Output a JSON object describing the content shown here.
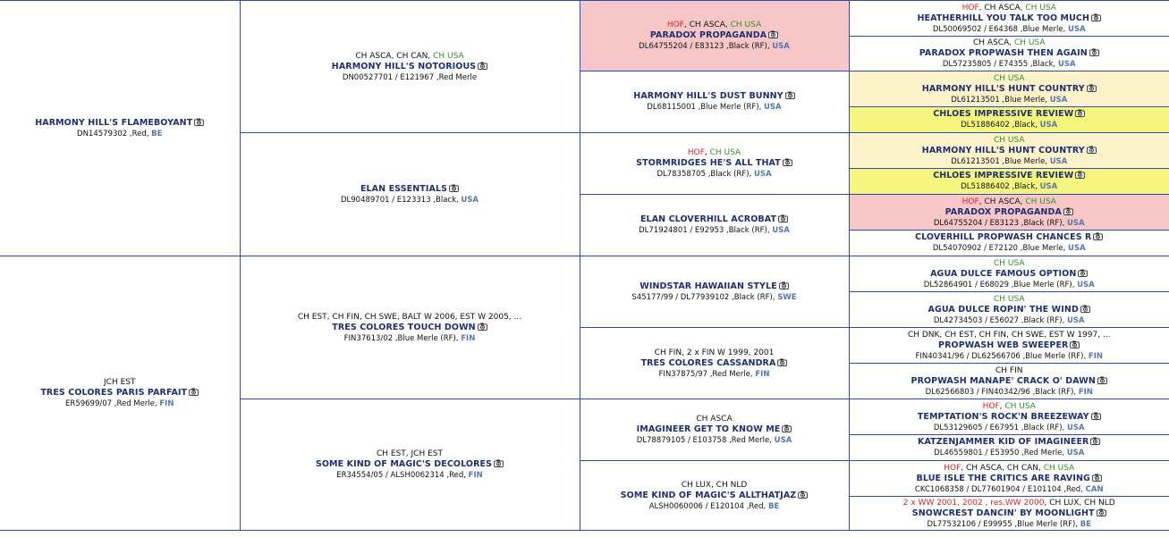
{
  "dogs": {
    "s": {
      "name": "HARMONY HILL'S FLAMEBOYANT",
      "reg": "DN14579302 ,Red, ",
      "country": "BE",
      "titles": []
    },
    "d": {
      "name": "TRES COLORES PARIS PARFAIT",
      "reg": "ER59699/07 ,Red Merle, ",
      "country": "FIN",
      "titles": [
        {
          "text": "JCH EST",
          "color": "black"
        }
      ]
    },
    "ss": {
      "name": "HARMONY HILL'S NOTORIOUS",
      "reg": "DN00527701 / E121967 ,Red Merle",
      "country": "",
      "titles": [
        {
          "text": "CH ASCA, CH CAN, ",
          "color": "black"
        },
        {
          "text": "CH USA",
          "color": "green"
        }
      ]
    },
    "sd": {
      "name": "ELAN ESSENTIALS",
      "reg": "DL90489701 / E123313 ,Black, ",
      "country": "USA",
      "titles": []
    },
    "ds": {
      "name": "TRES COLORES TOUCH DOWN",
      "reg": "FIN37613/02 ,Blue Merle (RF), ",
      "country": "FIN",
      "titles": [
        {
          "text": "CH EST, CH FIN, CH SWE, BALT W 2006, EST W 2005, ...",
          "color": "black"
        }
      ]
    },
    "dd": {
      "name": "SOME KIND OF MAGIC'S DECOLORES",
      "reg": "ER34554/05 / ALSH0062314 ,Red, ",
      "country": "FIN",
      "titles": [
        {
          "text": "CH EST, JCH EST",
          "color": "black"
        }
      ]
    },
    "sss": {
      "name": "PARADOX PROPAGANDA",
      "reg": "DL64755204 / E83123 ,Black (RF), ",
      "country": "USA",
      "titles": [
        {
          "text": "HOF",
          "color": "red"
        },
        {
          "text": ", CH ASCA, ",
          "color": "black"
        },
        {
          "text": "CH USA",
          "color": "green"
        }
      ]
    },
    "ssd": {
      "name": "HARMONY HILL'S DUST BUNNY",
      "reg": "DL68115001 ,Blue Merle (RF), ",
      "country": "USA",
      "titles": []
    },
    "sds": {
      "name": "STORMRIDGES HE'S ALL THAT",
      "reg": "DL78358705 ,Black (RF), ",
      "country": "USA",
      "titles": [
        {
          "text": "HOF",
          "color": "red"
        },
        {
          "text": ", ",
          "color": "black"
        },
        {
          "text": "CH USA",
          "color": "green"
        }
      ]
    },
    "sdd": {
      "name": "ELAN CLOVERHILL ACROBAT",
      "reg": "DL71924801 / E92953 ,Black (RF), ",
      "country": "USA",
      "titles": []
    },
    "dss": {
      "name": "WINDSTAR HAWAIIAN STYLE",
      "reg": "S45177/99 / DL77939102 ,Black (RF), ",
      "country": "SWE",
      "titles": []
    },
    "dsd": {
      "name": "TRES COLORES CASSANDRA",
      "reg": "FIN37875/97 ,Red Merle, ",
      "country": "FIN",
      "titles": [
        {
          "text": "CH FIN, 2 x FIN W 1999, 2001",
          "color": "black"
        }
      ]
    },
    "dds": {
      "name": "IMAGINEER GET TO KNOW ME",
      "reg": "DL78879105 / E103758 ,Red Merle, ",
      "country": "USA",
      "titles": [
        {
          "text": "CH ASCA",
          "color": "black"
        }
      ]
    },
    "ddd": {
      "name": "SOME KIND OF MAGIC'S ALLTHATJAZ",
      "reg": "ALSH0060006 / E120104 ,Red, ",
      "country": "BE",
      "titles": [
        {
          "text": "CH LUX, CH NLD",
          "color": "black"
        }
      ]
    },
    "ssss": {
      "name": "HEATHERHILL YOU TALK TOO MUCH",
      "reg": "DL50069502 / E64368 ,Blue Merle, ",
      "country": "USA",
      "titles": [
        {
          "text": "HOF",
          "color": "red"
        },
        {
          "text": ", CH ASCA, ",
          "color": "black"
        },
        {
          "text": "CH USA",
          "color": "green"
        }
      ]
    },
    "sssd": {
      "name": "PARADOX PROPWASH THEN AGAIN",
      "reg": "DL57235805 / E74355 ,Black, ",
      "country": "USA",
      "titles": [
        {
          "text": "CH ASCA, ",
          "color": "black"
        },
        {
          "text": "CH USA",
          "color": "green"
        }
      ]
    },
    "ssds": {
      "name": "HARMONY HILL'S HUNT COUNTRY",
      "reg": "DL61213501 ,Blue Merle, ",
      "country": "USA",
      "titles": [
        {
          "text": "CH USA",
          "color": "green"
        }
      ]
    },
    "ssdd": {
      "name": "CHLOES IMPRESSIVE REVIEW",
      "reg": "DL51886402 ,Black, ",
      "country": "USA",
      "titles": []
    },
    "sdss": {
      "name": "HARMONY HILL'S HUNT COUNTRY",
      "reg": "DL61213501 ,Blue Merle, ",
      "country": "USA",
      "titles": [
        {
          "text": "CH USA",
          "color": "green"
        }
      ]
    },
    "sdsd": {
      "name": "CHLOES IMPRESSIVE REVIEW",
      "reg": "DL51886402 ,Black, ",
      "country": "USA",
      "titles": []
    },
    "sdds": {
      "name": "PARADOX PROPAGANDA",
      "reg": "DL64755204 / E83123 ,Black (RF), ",
      "country": "USA",
      "titles": [
        {
          "text": "HOF",
          "color": "red"
        },
        {
          "text": ", CH ASCA, ",
          "color": "black"
        },
        {
          "text": "CH USA",
          "color": "green"
        }
      ]
    },
    "sddd": {
      "name": "CLOVERHILL PROPWASH CHANCES R",
      "reg": "DL54070902 / E72120 ,Blue Merle, ",
      "country": "USA",
      "titles": []
    },
    "dsss": {
      "name": "AGUA DULCE FAMOUS OPTION",
      "reg": "DL52864901 / E68029 ,Blue Merle (RF), ",
      "country": "USA",
      "titles": [
        {
          "text": "CH USA",
          "color": "green"
        }
      ]
    },
    "dssd": {
      "name": "AGUA DULCE ROPIN' THE WIND",
      "reg": "DL42734503 / E56027 ,Black (RF), ",
      "country": "USA",
      "titles": [
        {
          "text": "CH USA",
          "color": "green"
        }
      ]
    },
    "dsds": {
      "name": "PROPWASH WEB SWEEPER",
      "reg": "FIN40341/96 / DL62566706 ,Blue Merle (RF), ",
      "country": "FIN",
      "titles": [
        {
          "text": "CH DNK, CH EST, CH FIN, CH SWE, EST W 1997, ...",
          "color": "black"
        }
      ]
    },
    "dsdd": {
      "name": "PROPWASH MANAPE' CRACK O' DAWN",
      "reg": "DL62566803 / FIN40342/96 ,Black (RF), ",
      "country": "FIN",
      "titles": [
        {
          "text": "CH FIN",
          "color": "black"
        }
      ]
    },
    "ddss": {
      "name": "TEMPTATION'S ROCK'N BREEZEWAY",
      "reg": "DL53129605 / E67951 ,Black (RF), ",
      "country": "USA",
      "titles": [
        {
          "text": "HOF",
          "color": "red"
        },
        {
          "text": ", ",
          "color": "black"
        },
        {
          "text": "CH USA",
          "color": "green"
        }
      ]
    },
    "ddsd": {
      "name": "KATZENJAMMER KID OF IMAGINEER",
      "reg": "DL46559801 / E53950 ,Red Merle, ",
      "country": "USA",
      "titles": []
    },
    "ddds": {
      "name": "BLUE ISLE THE CRITICS ARE RAVING",
      "reg": "CKC1068358 / DL77601904 / E101104 ,Red, ",
      "country": "CAN",
      "titles": [
        {
          "text": "HOF",
          "color": "red"
        },
        {
          "text": ", CH ASCA, CH CAN, ",
          "color": "black"
        },
        {
          "text": "CH USA",
          "color": "green"
        }
      ]
    },
    "dddd": {
      "name": "SNOWCREST DANCIN' BY MOONLIGHT",
      "reg": "DL77532106 / E99955 ,Blue Merle (RF), ",
      "country": "BE",
      "titles": [
        {
          "text": "2 x WW 2001, 2002 , res.WW 2000",
          "color": "red"
        },
        {
          "text": ", CH LUX, CH NLD",
          "color": "black"
        }
      ]
    }
  },
  "colors": {
    "link": "#1f3070",
    "country": "#5577aa",
    "hof": "#e02020",
    "ch_usa": "#2f8f2f",
    "border": "#2e4bb5",
    "pink": "#f7c7c7",
    "cream": "#fdf3cb",
    "yellow": "#f4f57c"
  },
  "icon": "camera-icon"
}
